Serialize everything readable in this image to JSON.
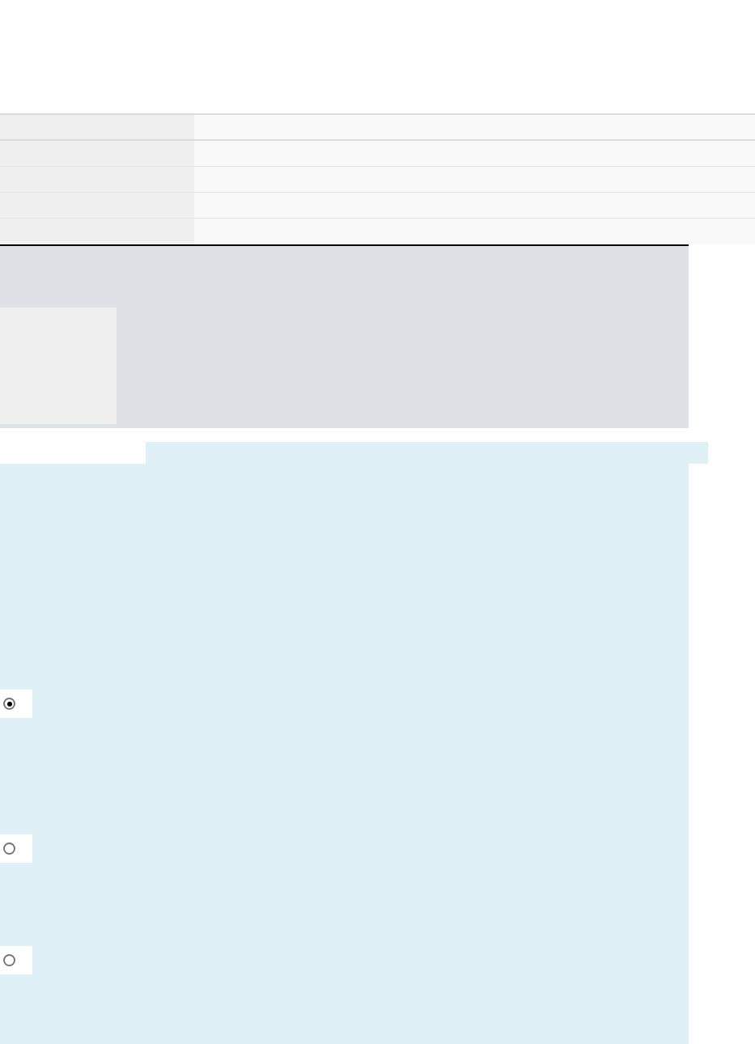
{
  "options": [
    {
      "selected": true
    },
    {
      "selected": false
    },
    {
      "selected": false
    }
  ]
}
